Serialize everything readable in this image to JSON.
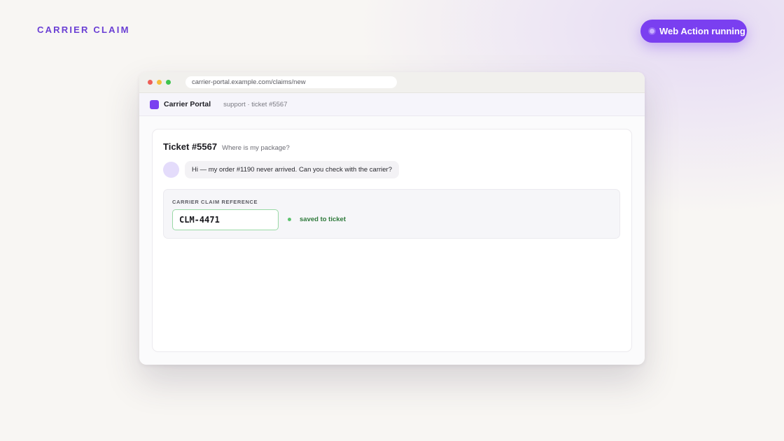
{
  "brand": {
    "title": "CARRIER CLAIM"
  },
  "status": {
    "label": "Web Action running"
  },
  "browser": {
    "url": "carrier-portal.example.com/claims/new"
  },
  "portal": {
    "name": "Carrier Portal",
    "breadcrumb": "support · ticket #5567"
  },
  "ticket": {
    "title": "Ticket #5567",
    "subject": "Where is my package?",
    "message": "Hi — my order #1190 never arrived. Can you check with the carrier?"
  },
  "claim": {
    "label": "CARRIER CLAIM REFERENCE",
    "value": "CLM-4471",
    "saved_status": "saved to ticket"
  },
  "colors": {
    "accent": "#7a3ff0",
    "brand_text": "#6a3fd4",
    "success": "#2f7a3c",
    "success_border": "#9ad9a6"
  }
}
